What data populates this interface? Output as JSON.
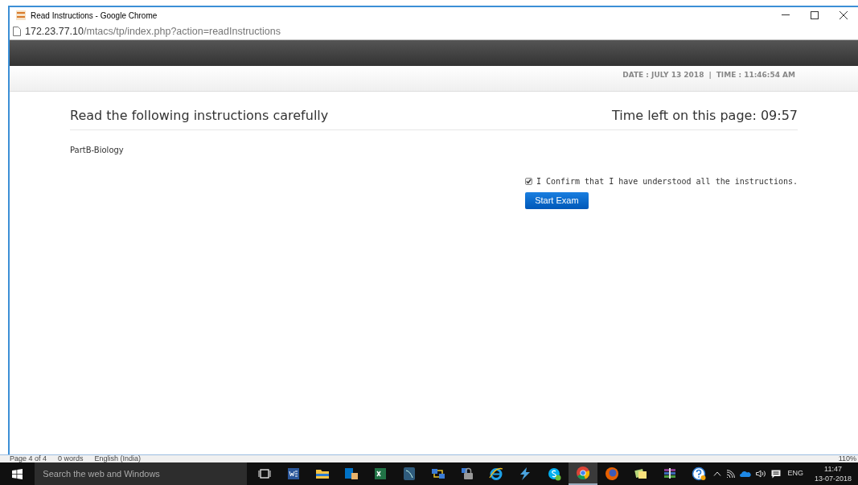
{
  "window": {
    "title": "Read Instructions - Google Chrome"
  },
  "address_bar": {
    "host": "172.23.77.10",
    "path": "/mtacs/tp/index.php?action=readInstructions"
  },
  "header": {
    "date": "DATE : JULY 13 2018",
    "separator": "|",
    "time": "TIME : 11:46:54 AM"
  },
  "page": {
    "heading": "Read the following instructions carefully",
    "timer": "Time left on this page: 09:57",
    "section": "PartB-Biology",
    "confirm": {
      "label": "I Confirm that I have understood all the instructions.",
      "checked": true
    },
    "button": "Start Exam"
  },
  "background_status_bar": {
    "left": [
      "Page 4 of 4",
      "0 words",
      "English (India)"
    ],
    "zoom": "110%"
  },
  "taskbar": {
    "search": {
      "placeholder": "Search the web and Windows"
    },
    "apps": [
      {
        "kind": "taskview",
        "selected": false
      },
      {
        "kind": "word",
        "selected": false
      },
      {
        "kind": "folder",
        "selected": false
      },
      {
        "kind": "outlook",
        "selected": false
      },
      {
        "kind": "excel",
        "selected": false
      },
      {
        "kind": "dolphin",
        "selected": false
      },
      {
        "kind": "network",
        "selected": false
      },
      {
        "kind": "lock",
        "selected": false
      },
      {
        "kind": "ie",
        "selected": false
      },
      {
        "kind": "bolt",
        "selected": false
      },
      {
        "kind": "skype",
        "selected": false
      },
      {
        "kind": "chrome",
        "selected": true
      },
      {
        "kind": "firefox",
        "selected": false
      },
      {
        "kind": "notes",
        "selected": false
      },
      {
        "kind": "archive",
        "selected": false
      },
      {
        "kind": "help",
        "selected": false
      }
    ],
    "language": "ENG",
    "clock": {
      "time": "11:47",
      "date": "13-07-2018"
    }
  }
}
